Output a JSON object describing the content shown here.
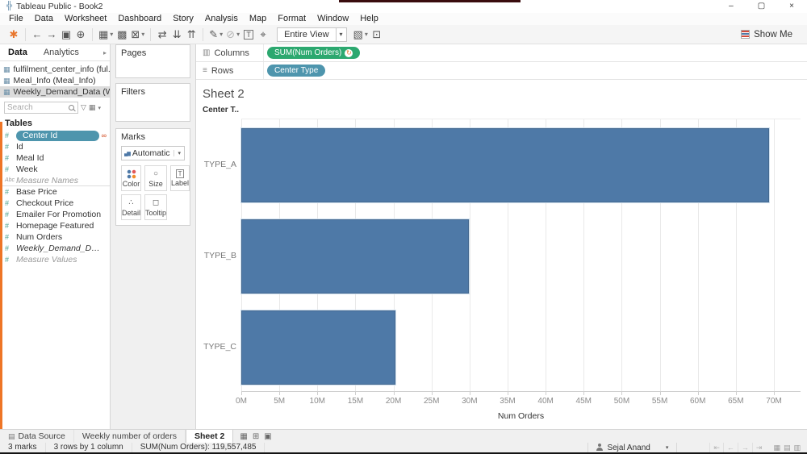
{
  "window": {
    "title": "Tableau Public - Book2",
    "app_icon": "╬",
    "minimize": "–",
    "maximize": "▢",
    "close": "×"
  },
  "menu": {
    "items": [
      "File",
      "Data",
      "Worksheet",
      "Dashboard",
      "Story",
      "Analysis",
      "Map",
      "Format",
      "Window",
      "Help"
    ]
  },
  "toolbar": {
    "icons": [
      {
        "name": "tableau-logo-icon",
        "glyph": "✱",
        "logo": true
      },
      {
        "name": "separator",
        "sep": true
      },
      {
        "name": "undo-icon",
        "glyph": "←"
      },
      {
        "name": "redo-icon",
        "glyph": "→"
      },
      {
        "name": "save-icon",
        "glyph": "▣"
      },
      {
        "name": "new-data-source-icon",
        "glyph": "⊕"
      },
      {
        "name": "separator",
        "sep": true
      },
      {
        "name": "new-worksheet-icon",
        "glyph": "▦",
        "dropdown": true,
        "caret": "▾"
      },
      {
        "name": "duplicate-sheet-icon",
        "glyph": "▩"
      },
      {
        "name": "clear-sheet-icon",
        "glyph": "⊠",
        "dropdown": true,
        "caret": "▾"
      },
      {
        "name": "separator",
        "sep": true
      },
      {
        "name": "swap-rows-columns-icon",
        "glyph": "⇄"
      },
      {
        "name": "sort-ascending-icon",
        "glyph": "⇊"
      },
      {
        "name": "sort-descending-icon",
        "glyph": "⇈"
      },
      {
        "name": "separator",
        "sep": true
      },
      {
        "name": "highlight-icon",
        "glyph": "✎",
        "dropdown": true,
        "caret": "▾"
      },
      {
        "name": "format-icon",
        "glyph": "⊘",
        "dim": true,
        "dropdown": true,
        "caret": "▾"
      },
      {
        "name": "show-mark-labels-icon",
        "glyph": "T",
        "boxed": true
      },
      {
        "name": "fix-axes-pin-icon",
        "glyph": "⌖"
      }
    ],
    "right_icons": [
      {
        "name": "show-hide-cards-icon",
        "glyph": "▧",
        "dropdown": true,
        "caret": "▾"
      },
      {
        "name": "presentation-mode-icon",
        "glyph": "⊡"
      }
    ],
    "view_mode": {
      "label": "Entire View",
      "caret": "▾"
    },
    "show_me_label": "Show Me"
  },
  "data_pane": {
    "tabs": {
      "data": "Data",
      "analytics": "Analytics",
      "arrow": "▸"
    },
    "sources": [
      {
        "glyph": "▦",
        "name": "fulfilment_center_info (ful..."
      },
      {
        "glyph": "▦",
        "name": "Meal_Info (Meal_Info)"
      },
      {
        "glyph": "▦",
        "name": "Weekly_Demand_Data (W...",
        "selected": true
      }
    ],
    "search": {
      "placeholder": "Search",
      "funnel": "▽",
      "layout": "▦",
      "caret": "▾"
    },
    "tables_header": "Tables",
    "fields": [
      {
        "glyph": "#",
        "name": "Center Id",
        "pill": true,
        "link": "∞"
      },
      {
        "glyph": "#",
        "name": "Id"
      },
      {
        "glyph": "#",
        "name": "Meal Id"
      },
      {
        "glyph": "#",
        "name": "Week"
      },
      {
        "glyph": "Abc",
        "abc": true,
        "name": "Measure Names",
        "italic": true,
        "gray": true,
        "sep": true
      },
      {
        "glyph": "#",
        "name": "Base Price"
      },
      {
        "glyph": "#",
        "name": "Checkout Price"
      },
      {
        "glyph": "#",
        "name": "Emailer For Promotion"
      },
      {
        "glyph": "#",
        "name": "Homepage Featured"
      },
      {
        "glyph": "#",
        "name": "Num Orders"
      },
      {
        "glyph": "#",
        "name": "Weekly_Demand_Data (Co...",
        "italic": true
      },
      {
        "glyph": "#",
        "name": "Measure Values",
        "italic": true,
        "gray": true
      }
    ]
  },
  "cards": {
    "pages_label": "Pages",
    "filters_label": "Filters",
    "marks_label": "Marks",
    "mark_type": {
      "icon": "▄▆",
      "label": "Automatic",
      "caret": "▾"
    },
    "buttons": [
      {
        "label": "Color",
        "color_icon": true
      },
      {
        "label": "Size",
        "glyph": "○"
      },
      {
        "label": "Label",
        "glyph": "T",
        "boxed": true
      },
      {
        "label": "Detail",
        "glyph": "∴"
      },
      {
        "label": "Tooltip",
        "glyph": "◻"
      }
    ]
  },
  "shelves": {
    "columns": {
      "icon": "▥",
      "label": "Columns",
      "pill": "SUM(Num Orders)",
      "badge": "↻"
    },
    "rows": {
      "icon": "≡",
      "label": "Rows",
      "pill": "Center Type"
    }
  },
  "sheet": {
    "title": "Sheet 2"
  },
  "chart_data": {
    "type": "bar",
    "orientation": "horizontal",
    "title": "Sheet 2",
    "column_field_header": "Center T..",
    "categories": [
      "TYPE_A",
      "TYPE_B",
      "TYPE_C"
    ],
    "values": [
      69.4,
      29.9,
      20.3
    ],
    "value_unit": "millions of orders",
    "total_label": "SUM(Num Orders): 119,557,485",
    "xlabel": "Num Orders",
    "ylabel": "",
    "xlim": [
      0,
      73.5
    ],
    "x_tick_values": [
      0,
      5,
      10,
      15,
      20,
      25,
      30,
      35,
      40,
      45,
      50,
      55,
      60,
      65,
      70
    ],
    "x_tick_labels": [
      "0M",
      "5M",
      "10M",
      "15M",
      "20M",
      "25M",
      "30M",
      "35M",
      "40M",
      "45M",
      "50M",
      "55M",
      "60M",
      "65M",
      "70M"
    ],
    "grid": true,
    "legend": "none",
    "bar_color": "#4e79a7"
  },
  "sheet_tabs": {
    "data_source": {
      "glyph": "▤",
      "label": "Data Source"
    },
    "tabs": [
      {
        "label": "Weekly number of orders"
      },
      {
        "label": "Sheet 2",
        "active": true
      }
    ],
    "new_icons": [
      {
        "name": "new-worksheet-tab-icon",
        "glyph": "▦"
      },
      {
        "name": "new-dashboard-tab-icon",
        "glyph": "⊞"
      },
      {
        "name": "new-story-tab-icon",
        "glyph": "▣"
      }
    ]
  },
  "status_bar": {
    "marks": "3 marks",
    "dimensions": "3 rows by 1 column",
    "aggregate": "SUM(Num Orders): 119,557,485",
    "user_name": "Sejal Anand",
    "user_caret": "▾",
    "nav": [
      {
        "name": "first-page-icon",
        "glyph": "⇤"
      },
      {
        "name": "prev-page-icon",
        "glyph": "←"
      },
      {
        "name": "next-page-icon",
        "glyph": "→"
      },
      {
        "name": "last-page-icon",
        "glyph": "⇥"
      }
    ],
    "views": [
      {
        "name": "grid-view-icon",
        "glyph": "▦"
      },
      {
        "name": "film-view-icon",
        "glyph": "▤"
      },
      {
        "name": "matrix-view-icon",
        "glyph": "▥"
      }
    ]
  },
  "colors": {
    "bar_blue": "#4e79a7",
    "pill_green": "#2ca86f",
    "pill_blue": "#4e95ad",
    "accent_orange": "#e8762d",
    "strip_orange": "#ee7526"
  }
}
